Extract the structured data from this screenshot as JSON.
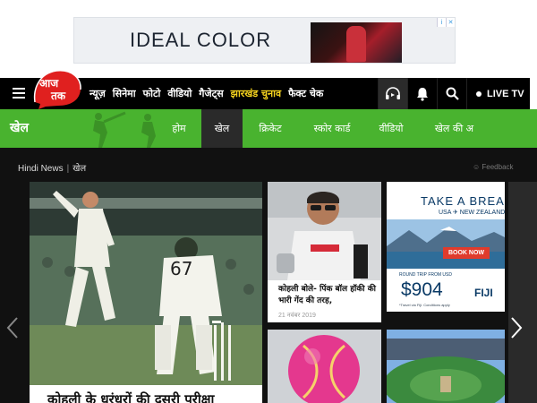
{
  "ad_banner": {
    "text": "IDEAL COLOR"
  },
  "header": {
    "logo_text": "आज तक",
    "nav_items": [
      {
        "label": "न्यूज़",
        "highlight": false
      },
      {
        "label": "सिनेमा",
        "highlight": false
      },
      {
        "label": "फोटो",
        "highlight": false
      },
      {
        "label": "वीडियो",
        "highlight": false
      },
      {
        "label": "गैजेट्स",
        "highlight": false
      },
      {
        "label": "झारखंड चुनाव",
        "highlight": true
      },
      {
        "label": "फैक्ट चेक",
        "highlight": false
      }
    ],
    "live_tv_label": "LIVE TV"
  },
  "section": {
    "title": "खेल",
    "tabs": [
      "होम",
      "खेल",
      "क्रिकेट",
      "स्कोर कार्ड",
      "वीडियो",
      "खेल की अ"
    ],
    "active_tab_index": 1
  },
  "breadcrumb": {
    "home": "Hindi News",
    "current": "खेल"
  },
  "feedback_label": "Feedback",
  "featured": {
    "caption": "कोहली के धुरंधरों की दूसरी परीक्षा",
    "jersey_number": "67"
  },
  "cards": [
    {
      "title": "कोहली बोले- पिंक बॉल हॉकी की भारी गेंद की तरह,",
      "date": "21 नवंबर 2019"
    }
  ],
  "ad_card": {
    "headline": "TAKE A BREAK",
    "route": "USA ✈ NEW ZEALAND",
    "button": "BOOK NOW",
    "fare_label": "ROUND TRIP FROM USD",
    "price": "$904",
    "fine_print": "*Travel via Fiji. Conditions apply",
    "airline": "FIJI"
  },
  "colors": {
    "section_green": "#49b32f",
    "nav_black": "#000000",
    "highlight_yellow": "#f4d21e",
    "logo_red": "#e0201f"
  }
}
